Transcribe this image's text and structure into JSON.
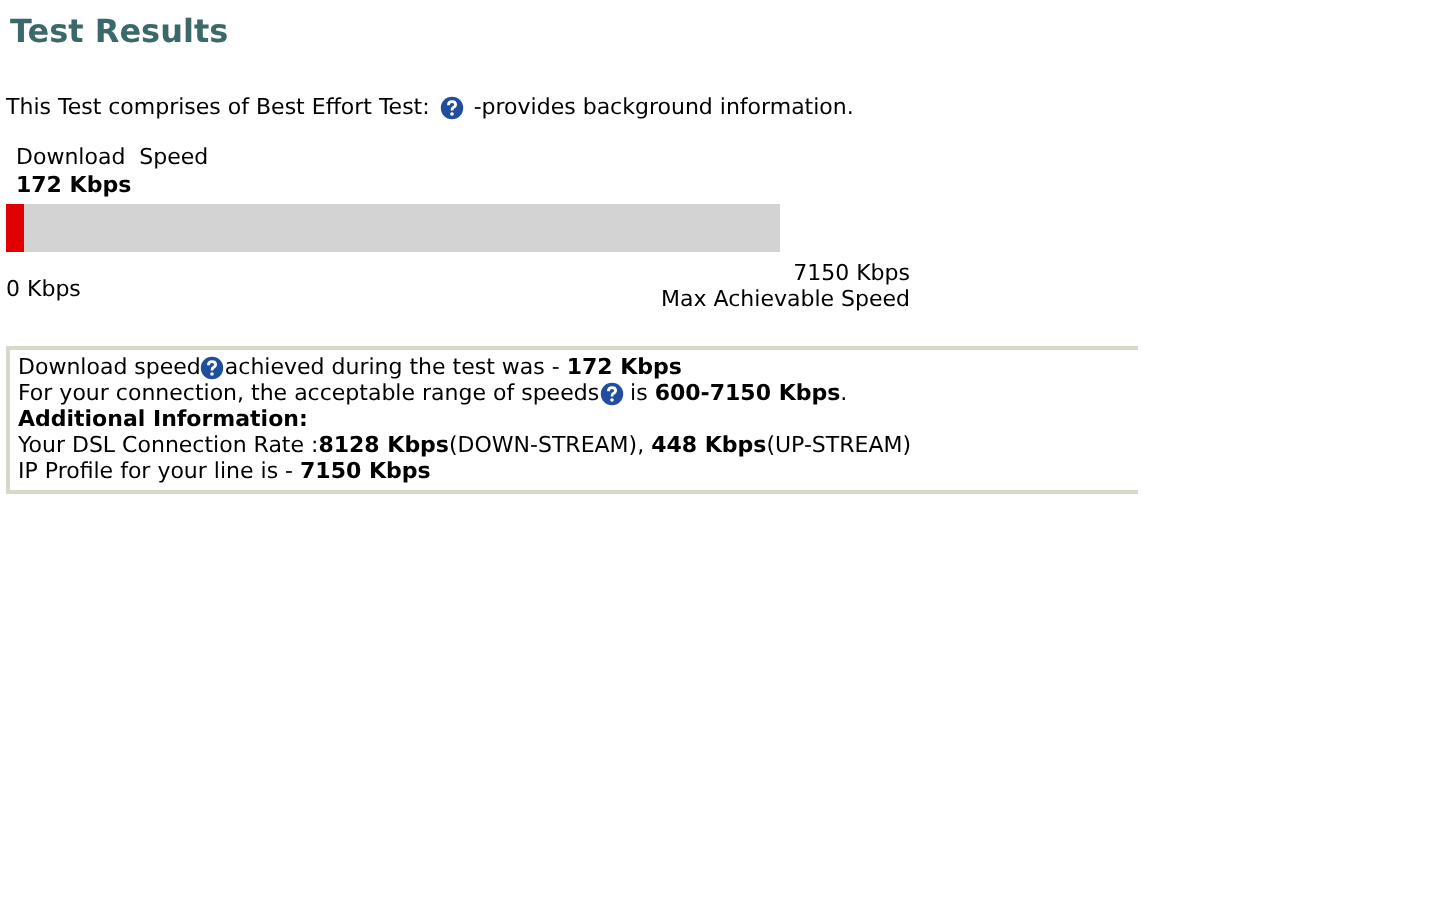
{
  "title": "Test Results",
  "intro": {
    "before": "This Test comprises of Best Effort Test:",
    "after": "-provides background information."
  },
  "gauge": {
    "label": "Download  Speed",
    "value": "172 Kbps",
    "level": 0.024,
    "min_label": "0 Kbps",
    "max_label": "7150 Kbps",
    "max_caption": "Max Achievable Speed"
  },
  "info": [
    {
      "kind": "text",
      "segments": [
        {
          "kind": "text",
          "text": "Download speed"
        },
        {
          "kind": "help"
        },
        {
          "kind": "text",
          "text": "achieved during the test was - **172 Kbps**"
        }
      ]
    },
    {
      "kind": "text",
      "segments": [
        {
          "kind": "text",
          "text": "For your connection, the acceptable range of speeds"
        },
        {
          "kind": "help"
        },
        {
          "kind": "text",
          "text": " is **600-7150 Kbps**."
        }
      ]
    },
    {
      "kind": "heading",
      "segments": [
        {
          "kind": "text",
          "text": "Additional Information:"
        }
      ]
    },
    {
      "kind": "text",
      "segments": [
        {
          "kind": "text",
          "text": "Your DSL Connection Rate :**8128 Kbps**(DOWN-STREAM), **448 Kbps**(UP-STREAM)"
        }
      ]
    },
    {
      "kind": "text",
      "segments": [
        {
          "kind": "text",
          "text": "IP Profile for your line is - **7150 Kbps**"
        }
      ]
    }
  ]
}
